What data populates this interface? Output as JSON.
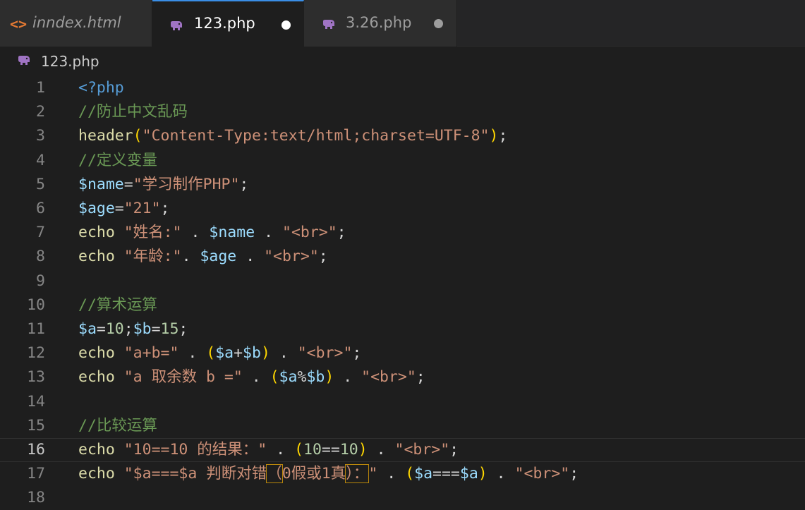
{
  "tabs": [
    {
      "label": "inndex.html",
      "icon": "html-icon",
      "active": false,
      "dirty": false
    },
    {
      "label": "123.php",
      "icon": "php-elephant-icon",
      "active": true,
      "dirty": true
    },
    {
      "label": "3.26.php",
      "icon": "php-elephant-icon",
      "active": false,
      "dirty": true
    }
  ],
  "breadcrumb": {
    "file": "123.php",
    "icon": "php-elephant-icon"
  },
  "editor": {
    "current_line": 16,
    "line_numbers": [
      "1",
      "2",
      "3",
      "4",
      "5",
      "6",
      "7",
      "8",
      "9",
      "10",
      "11",
      "12",
      "13",
      "14",
      "15",
      "16",
      "17",
      "18"
    ],
    "lines": [
      [
        {
          "t": "<?php",
          "c": "kw"
        }
      ],
      [
        {
          "t": "//防止中文乱码",
          "c": "cm"
        }
      ],
      [
        {
          "t": "header",
          "c": "fn"
        },
        {
          "t": "(",
          "c": "p1"
        },
        {
          "t": "\"Content-Type:text/html;charset=UTF-8\"",
          "c": "st"
        },
        {
          "t": ")",
          "c": "p1"
        },
        {
          "t": ";",
          "c": "op"
        }
      ],
      [
        {
          "t": "//定义变量",
          "c": "cm"
        }
      ],
      [
        {
          "t": "$name",
          "c": "vr"
        },
        {
          "t": "=",
          "c": "op"
        },
        {
          "t": "\"学习制作PHP\"",
          "c": "st"
        },
        {
          "t": ";",
          "c": "op"
        }
      ],
      [
        {
          "t": "$age",
          "c": "vr"
        },
        {
          "t": "=",
          "c": "op"
        },
        {
          "t": "\"21\"",
          "c": "st"
        },
        {
          "t": ";",
          "c": "op"
        }
      ],
      [
        {
          "t": "echo ",
          "c": "fn"
        },
        {
          "t": "\"姓名:\"",
          "c": "st"
        },
        {
          "t": " . ",
          "c": "op"
        },
        {
          "t": "$name",
          "c": "vr"
        },
        {
          "t": " . ",
          "c": "op"
        },
        {
          "t": "\"<br>\"",
          "c": "st"
        },
        {
          "t": ";",
          "c": "op"
        }
      ],
      [
        {
          "t": "echo ",
          "c": "fn"
        },
        {
          "t": "\"年龄:\"",
          "c": "st"
        },
        {
          "t": ". ",
          "c": "op"
        },
        {
          "t": "$age",
          "c": "vr"
        },
        {
          "t": " . ",
          "c": "op"
        },
        {
          "t": "\"<br>\"",
          "c": "st"
        },
        {
          "t": ";",
          "c": "op"
        }
      ],
      [],
      [
        {
          "t": "//算术运算",
          "c": "cm"
        }
      ],
      [
        {
          "t": "$a",
          "c": "vr"
        },
        {
          "t": "=",
          "c": "op"
        },
        {
          "t": "10",
          "c": "nm"
        },
        {
          "t": ";",
          "c": "op"
        },
        {
          "t": "$b",
          "c": "vr"
        },
        {
          "t": "=",
          "c": "op"
        },
        {
          "t": "15",
          "c": "nm"
        },
        {
          "t": ";",
          "c": "op"
        }
      ],
      [
        {
          "t": "echo ",
          "c": "fn"
        },
        {
          "t": "\"a+b=\"",
          "c": "st"
        },
        {
          "t": " . ",
          "c": "op"
        },
        {
          "t": "(",
          "c": "p1"
        },
        {
          "t": "$a",
          "c": "vr"
        },
        {
          "t": "+",
          "c": "op"
        },
        {
          "t": "$b",
          "c": "vr"
        },
        {
          "t": ")",
          "c": "p1"
        },
        {
          "t": " . ",
          "c": "op"
        },
        {
          "t": "\"<br>\"",
          "c": "st"
        },
        {
          "t": ";",
          "c": "op"
        }
      ],
      [
        {
          "t": "echo ",
          "c": "fn"
        },
        {
          "t": "\"a 取余数 b =\"",
          "c": "st"
        },
        {
          "t": " . ",
          "c": "op"
        },
        {
          "t": "(",
          "c": "p1"
        },
        {
          "t": "$a",
          "c": "vr"
        },
        {
          "t": "%",
          "c": "op"
        },
        {
          "t": "$b",
          "c": "vr"
        },
        {
          "t": ")",
          "c": "p1"
        },
        {
          "t": " . ",
          "c": "op"
        },
        {
          "t": "\"<br>\"",
          "c": "st"
        },
        {
          "t": ";",
          "c": "op"
        }
      ],
      [],
      [
        {
          "t": "//比较运算",
          "c": "cm"
        }
      ],
      [
        {
          "t": "echo ",
          "c": "fn"
        },
        {
          "t": "\"10==10 的结果：\"",
          "c": "st"
        },
        {
          "t": " . ",
          "c": "op"
        },
        {
          "t": "(",
          "c": "p1"
        },
        {
          "t": "10",
          "c": "nm"
        },
        {
          "t": "==",
          "c": "op"
        },
        {
          "t": "10",
          "c": "nm"
        },
        {
          "t": ")",
          "c": "p1"
        },
        {
          "t": " . ",
          "c": "op"
        },
        {
          "t": "\"<br>\"",
          "c": "st"
        },
        {
          "t": ";",
          "c": "op"
        }
      ],
      [
        {
          "t": "echo ",
          "c": "fn"
        },
        {
          "t": "\"$a===$a 判断对错",
          "c": "st"
        },
        {
          "t": "（",
          "c": "st",
          "box": true
        },
        {
          "t": "0假或1真",
          "c": "st"
        },
        {
          "t": "）：",
          "c": "st",
          "box": true
        },
        {
          "t": "\"",
          "c": "st"
        },
        {
          "t": " . ",
          "c": "op"
        },
        {
          "t": "(",
          "c": "p1"
        },
        {
          "t": "$a",
          "c": "vr"
        },
        {
          "t": "===",
          "c": "op"
        },
        {
          "t": "$a",
          "c": "vr"
        },
        {
          "t": ")",
          "c": "p1"
        },
        {
          "t": " . ",
          "c": "op"
        },
        {
          "t": "\"<br>\"",
          "c": "st"
        },
        {
          "t": ";",
          "c": "op"
        }
      ],
      []
    ]
  }
}
